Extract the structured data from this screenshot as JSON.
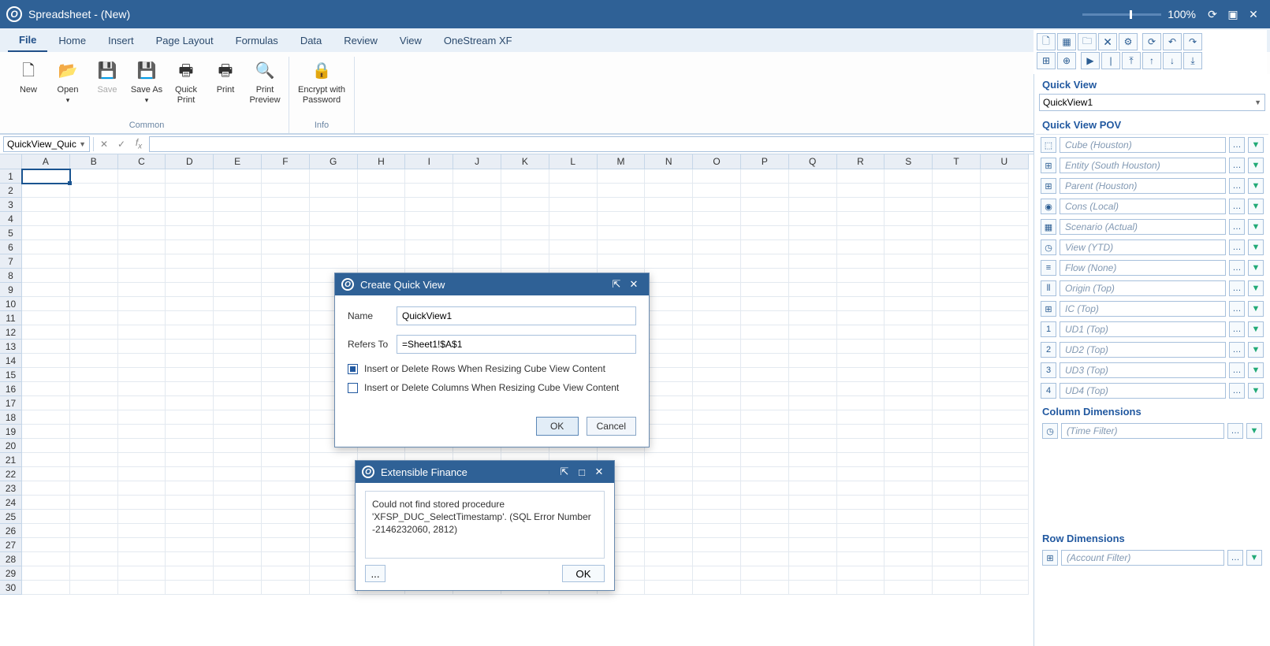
{
  "window": {
    "title": "Spreadsheet - (New)",
    "zoom": "100%"
  },
  "menu": {
    "tabs": [
      "File",
      "Home",
      "Insert",
      "Page Layout",
      "Formulas",
      "Data",
      "Review",
      "View",
      "OneStream XF"
    ],
    "active": "File"
  },
  "ribbon": {
    "common_label": "Common",
    "info_label": "Info",
    "new": "New",
    "open": "Open",
    "save": "Save",
    "save_as": "Save As",
    "quick_print": "Quick Print",
    "print": "Print",
    "print_preview": "Print Preview",
    "encrypt": "Encrypt with Password"
  },
  "formula": {
    "namebox": "QuickView_Quic",
    "value": ""
  },
  "grid": {
    "columns": [
      "A",
      "B",
      "C",
      "D",
      "E",
      "F",
      "G",
      "H",
      "I",
      "J",
      "K",
      "L",
      "M",
      "N",
      "O",
      "P",
      "Q",
      "R",
      "S",
      "T",
      "U"
    ],
    "rows": 30
  },
  "right": {
    "quick_view_title": "Quick View",
    "quick_view_value": "QuickView1",
    "pov_title": "Quick View POV",
    "pov": [
      {
        "icon": "⬚",
        "label": "Cube (Houston)"
      },
      {
        "icon": "⊞",
        "label": "Entity (South Houston)"
      },
      {
        "icon": "⊞",
        "label": "Parent (Houston)"
      },
      {
        "icon": "◉",
        "label": "Cons (Local)"
      },
      {
        "icon": "▦",
        "label": "Scenario (Actual)"
      },
      {
        "icon": "◷",
        "label": "View (YTD)"
      },
      {
        "icon": "≡",
        "label": "Flow (None)"
      },
      {
        "icon": "⦀",
        "label": "Origin (Top)"
      },
      {
        "icon": "⊞",
        "label": "IC (Top)"
      },
      {
        "icon": "1",
        "label": "UD1 (Top)"
      },
      {
        "icon": "2",
        "label": "UD2 (Top)"
      },
      {
        "icon": "3",
        "label": "UD3 (Top)"
      },
      {
        "icon": "4",
        "label": "UD4 (Top)"
      }
    ],
    "col_dim_title": "Column Dimensions",
    "col_dim": {
      "icon": "◷",
      "label": "(Time Filter)"
    },
    "row_dim_title": "Row Dimensions",
    "row_dim": {
      "icon": "⊞",
      "label": "(Account Filter)"
    }
  },
  "dlg_qv": {
    "title": "Create Quick View",
    "name_label": "Name",
    "name_value": "QuickView1",
    "refers_label": "Refers To",
    "refers_value": "=Sheet1!$A$1",
    "check_rows": "Insert or Delete Rows When Resizing Cube View Content",
    "check_cols": "Insert or Delete Columns When Resizing Cube View Content",
    "ok": "OK",
    "cancel": "Cancel"
  },
  "dlg_err": {
    "title": "Extensible Finance",
    "message": "Could not find stored procedure 'XFSP_DUC_SelectTimestamp'. (SQL Error Number -2146232060, 2812)",
    "more": "...",
    "ok": "OK"
  }
}
